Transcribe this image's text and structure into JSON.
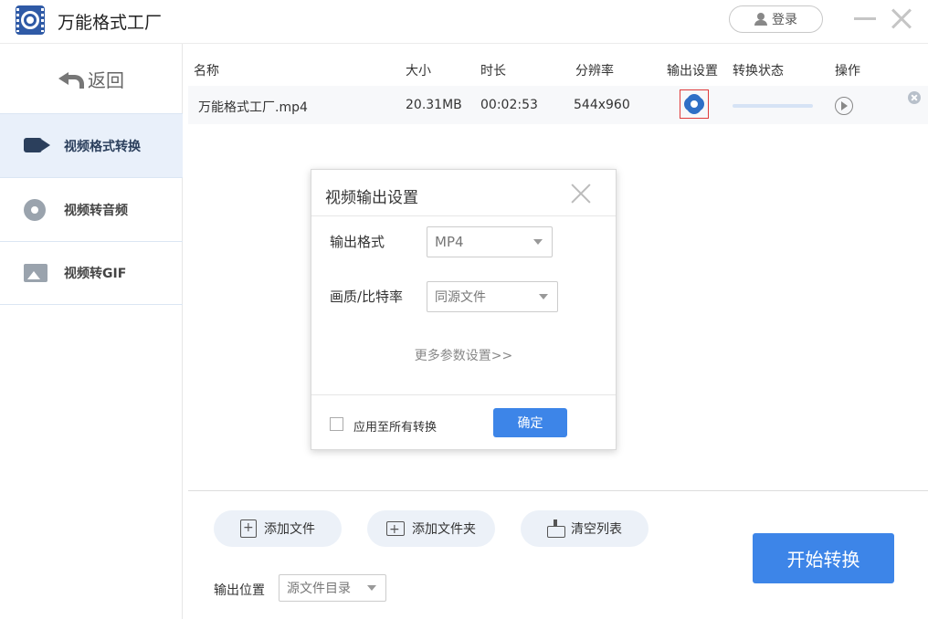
{
  "app": {
    "title": "万能格式工厂",
    "login_label": "登录"
  },
  "sidebar": {
    "back_label": "返回",
    "items": [
      {
        "label": "视频格式转换",
        "icon": "video-convert-icon",
        "active": true
      },
      {
        "label": "视频转音频",
        "icon": "audio-disc-icon",
        "active": false
      },
      {
        "label": "视频转GIF",
        "icon": "gif-image-icon",
        "active": false
      }
    ]
  },
  "table": {
    "columns": [
      "名称",
      "大小",
      "时长",
      "分辨率",
      "输出设置",
      "转换状态",
      "操作"
    ],
    "rows": [
      {
        "name": "万能格式工厂.mp4",
        "size": "20.31MB",
        "duration": "00:02:53",
        "resolution": "544x960",
        "progress": 0
      }
    ]
  },
  "toolbar": {
    "add_file": "添加文件",
    "add_folder": "添加文件夹",
    "clear_list": "清空列表",
    "output_location_label": "输出位置",
    "output_location_value": "源文件目录",
    "start_label": "开始转换"
  },
  "dialog": {
    "title": "视频输出设置",
    "format_label": "输出格式",
    "format_value": "MP4",
    "quality_label": "画质/比特率",
    "quality_value": "同源文件",
    "more_settings": "更多参数设置>>",
    "apply_all_label": "应用至所有转换",
    "confirm_label": "确定"
  },
  "colors": {
    "accent": "#3d85e8",
    "highlight_border": "#e03a3a",
    "active_nav_bg": "#e9f0fa"
  }
}
